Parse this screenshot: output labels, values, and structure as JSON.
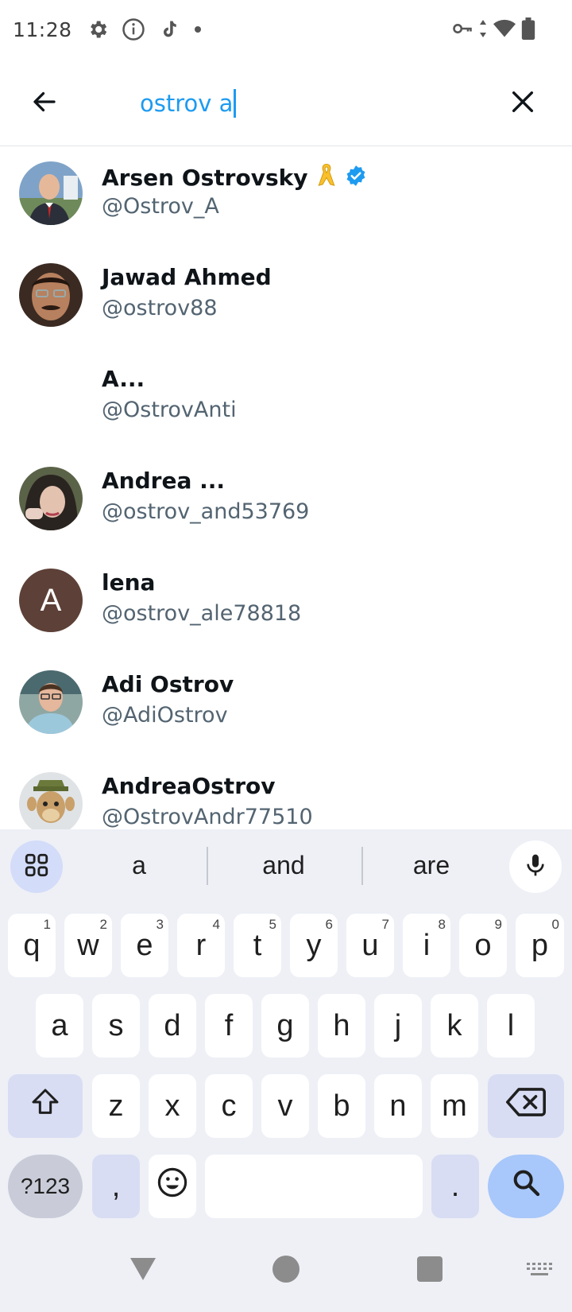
{
  "status_bar": {
    "time": "11:28",
    "left_icons": [
      "gear-icon",
      "info-icon",
      "music-note-icon",
      "dot-icon"
    ],
    "right_icons": [
      "vpn-key-icon",
      "data-arrows-icon",
      "wifi-icon",
      "battery-icon"
    ]
  },
  "search": {
    "query": "ostrov a",
    "back_icon": "arrow-left-icon",
    "clear_icon": "close-icon",
    "accent_color": "#1d9bf0"
  },
  "results": [
    {
      "name": "Arsen Ostrovsky",
      "handle": "@Ostrov_A",
      "badges": [
        "ribbon-emoji",
        "verified-icon"
      ],
      "avatar": "photo"
    },
    {
      "name": "Jawad Ahmed",
      "handle": "@ostrov88",
      "avatar": "photo"
    },
    {
      "name": "A...",
      "handle": "@OstrovAnti",
      "avatar": "none"
    },
    {
      "name": "Andrea ...",
      "handle": "@ostrov_and53769",
      "avatar": "photo"
    },
    {
      "name": "lena",
      "handle": "@ostrov_ale78818",
      "avatar": "letter",
      "avatar_letter": "A",
      "avatar_color": "#5d4037"
    },
    {
      "name": "Adi Ostrov",
      "handle": "@AdiOstrov",
      "avatar": "photo"
    },
    {
      "name": "AndreaOstrov",
      "handle": "@OstrovAndr77510",
      "avatar": "cartoon"
    }
  ],
  "keyboard": {
    "suggestions": [
      "a",
      "and",
      "are"
    ],
    "row1": [
      {
        "key": "q",
        "hint": "1"
      },
      {
        "key": "w",
        "hint": "2"
      },
      {
        "key": "e",
        "hint": "3"
      },
      {
        "key": "r",
        "hint": "4"
      },
      {
        "key": "t",
        "hint": "5"
      },
      {
        "key": "y",
        "hint": "6"
      },
      {
        "key": "u",
        "hint": "7"
      },
      {
        "key": "i",
        "hint": "8"
      },
      {
        "key": "o",
        "hint": "9"
      },
      {
        "key": "p",
        "hint": "0"
      }
    ],
    "row2": [
      "a",
      "s",
      "d",
      "f",
      "g",
      "h",
      "j",
      "k",
      "l"
    ],
    "row3": [
      "z",
      "x",
      "c",
      "v",
      "b",
      "n",
      "m"
    ],
    "symbols_label": "?123",
    "comma": ",",
    "period": "."
  },
  "nav_bar": {
    "icons": [
      "back-triangle-icon",
      "home-circle-icon",
      "recents-square-icon",
      "keyboard-switch-icon"
    ]
  }
}
